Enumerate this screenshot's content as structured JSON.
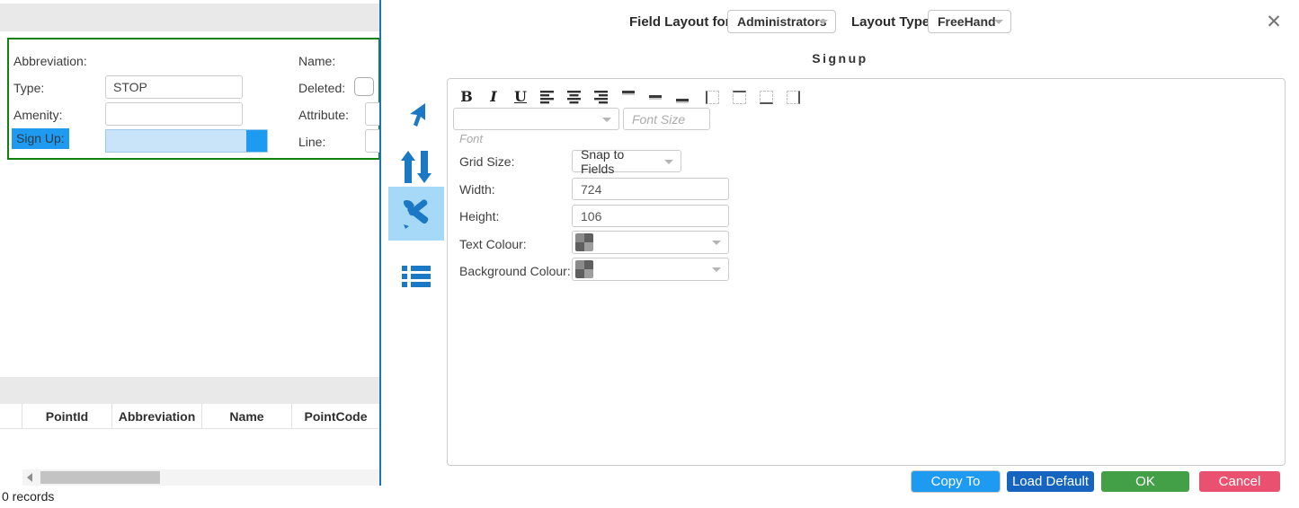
{
  "app": {
    "form": {
      "left_column": [
        {
          "label": "Abbreviation:"
        },
        {
          "label": "Type:",
          "value": "STOP"
        },
        {
          "label": "Amenity:",
          "value": ""
        },
        {
          "label": "Sign Up:",
          "value": "",
          "state": "selected"
        }
      ],
      "right_column": [
        {
          "label": "Name:"
        },
        {
          "label": "Deleted:",
          "checked": false
        },
        {
          "label": "Attribute:",
          "value": ""
        },
        {
          "label": "Line:",
          "value": ""
        }
      ]
    },
    "grid": {
      "columns": [
        "PointId",
        "Abbreviation",
        "Name",
        "PointCode"
      ],
      "rows": [],
      "status": "0 records"
    }
  },
  "dialog": {
    "header": {
      "field_layout_label": "Field Layout for:",
      "field_layout_value": "Administrators",
      "layout_type_label": "Layout Type:",
      "layout_type_value": "FreeHand",
      "close_icon": "✕"
    },
    "title": "Signup",
    "side_toolbar": [
      {
        "name": "select-cursor",
        "selected": false
      },
      {
        "name": "reorder-fields",
        "selected": false
      },
      {
        "name": "field-properties",
        "selected": true
      },
      {
        "name": "field-list",
        "selected": false
      }
    ],
    "format_toolbar": {
      "bold": "B",
      "italic": "I",
      "underline": "U"
    },
    "font": {
      "label": "Font",
      "value": "",
      "size_placeholder": "Font Size"
    },
    "properties": [
      {
        "label": "Grid Size:",
        "control": "select",
        "value": "Snap to Fields"
      },
      {
        "label": "Width:",
        "control": "input",
        "value": "724"
      },
      {
        "label": "Height:",
        "control": "input",
        "value": "106"
      },
      {
        "label": "Text Colour:",
        "control": "color-select",
        "value": ""
      },
      {
        "label": "Background Colour:",
        "control": "color-select",
        "value": ""
      }
    ],
    "buttons": [
      {
        "label": "Copy To",
        "color": "#1e9bf0"
      },
      {
        "label": "Load Default",
        "color": "#1565c0"
      },
      {
        "label": "OK",
        "color": "#43a047"
      },
      {
        "label": "Cancel",
        "color": "#ea506f"
      }
    ],
    "accent_colors": {
      "tool_icon_blue": "#1b78c4",
      "selected_tool_bg": "#a6d9f7",
      "selected_field_bg": "#c9e4f8",
      "selected_field_accent": "#1e9af0",
      "splitter_blue": "#1c74b4",
      "canvas_border_green": "#118011"
    }
  }
}
